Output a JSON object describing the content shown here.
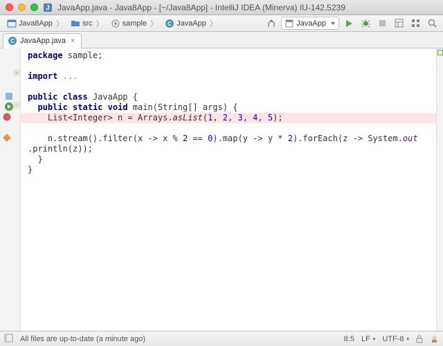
{
  "window": {
    "title": "JavaApp.java - Java8App - [~/Java8App] - IntelliJ IDEA (Minerva) IU-142.5239"
  },
  "breadcrumb": {
    "project": "Java8App",
    "src": "src",
    "pkg": "sample",
    "cls": "JavaApp"
  },
  "run_config": {
    "selected": "JavaApp"
  },
  "tab": {
    "title": "JavaApp.java"
  },
  "code": {
    "l1a": "package",
    "l1b": " sample;",
    "l3a": "import",
    "l3b": " ",
    "l3c": "...",
    "l5a": "public",
    "l5b": " ",
    "l5c": "class",
    "l5d": " JavaApp {",
    "l6a": "  ",
    "l6b": "public",
    "l6c": " ",
    "l6d": "static",
    "l6e": " ",
    "l6f": "void",
    "l6g": " main(String[] args) {",
    "l7a": "    List<Integer> n = Arrays.",
    "l7b": "asList",
    "l7c": "(",
    "l7d": "1",
    "l7e": ", ",
    "l7f": "2",
    "l7g": ", ",
    "l7h": "3",
    "l7i": ", ",
    "l7j": "4",
    "l7k": ", ",
    "l7l": "5",
    "l7m": ");",
    "l9a": "    n.stream().filter(x -> x % ",
    "l9b": "2",
    "l9c": " == ",
    "l9d": "0",
    "l9e": ").map(y -> y * ",
    "l9f": "2",
    "l9g": ").forEach(z -> System.",
    "l9h": "out",
    "l10a": ".println(z));",
    "l11a": "  }",
    "l12a": "}"
  },
  "status": {
    "message": "All files are up-to-date (a minute ago)",
    "pos": "8:5",
    "linesep": "LF",
    "encoding": "UTF-8"
  }
}
